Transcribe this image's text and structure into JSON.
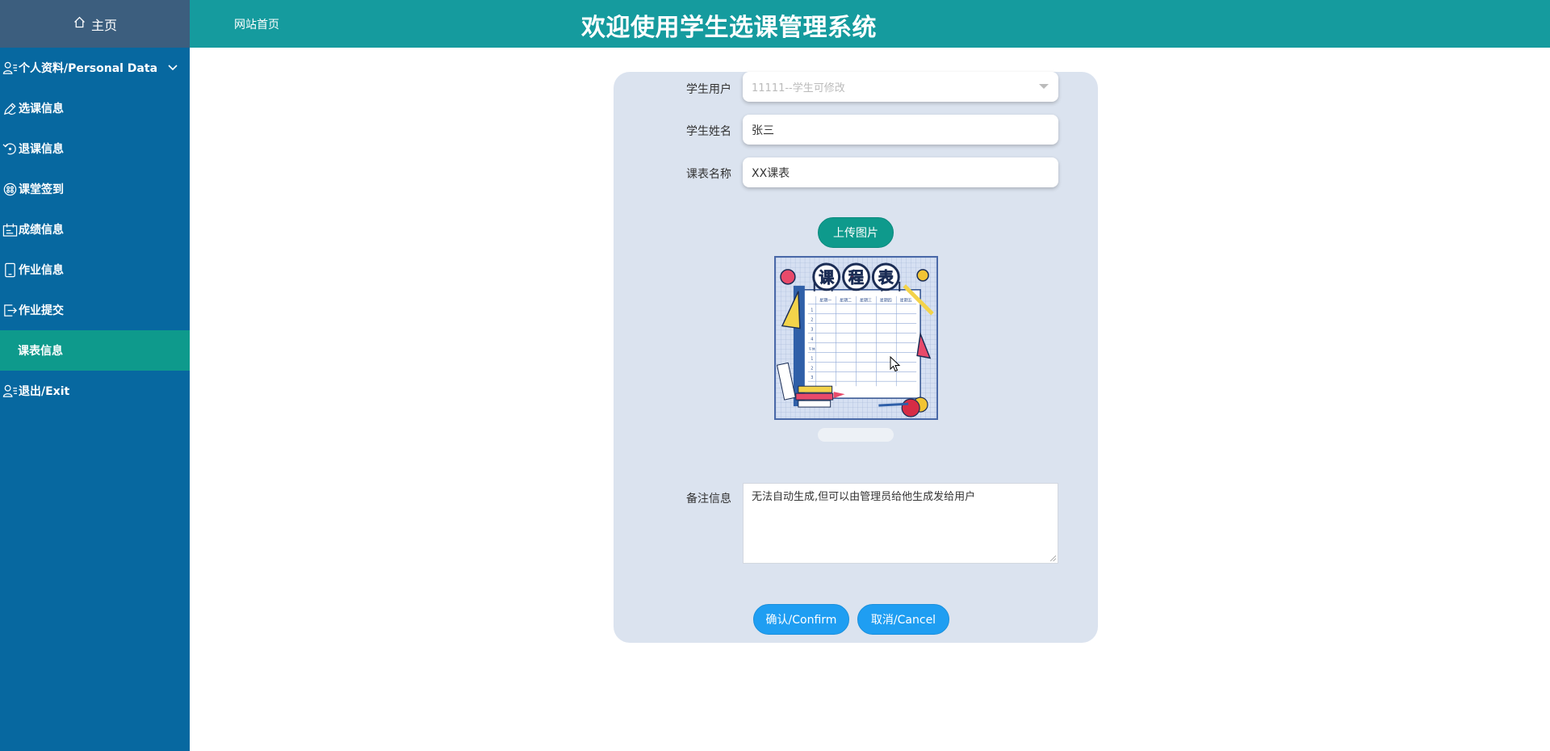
{
  "sidebar": {
    "home": {
      "label": "主页",
      "icon": "home-icon"
    },
    "items": [
      {
        "label": "个人资料/Personal Data",
        "icon": "user-icon",
        "expandable": true
      },
      {
        "label": "选课信息",
        "icon": "pen-icon"
      },
      {
        "label": "退课信息",
        "icon": "undo-icon"
      },
      {
        "label": "课堂签到",
        "icon": "checkin-icon"
      },
      {
        "label": "成绩信息",
        "icon": "score-icon"
      },
      {
        "label": "作业信息",
        "icon": "tablet-icon"
      },
      {
        "label": "作业提交",
        "icon": "submit-icon"
      },
      {
        "label": "课表信息",
        "icon": "",
        "active": true
      },
      {
        "label": "退出/Exit",
        "icon": "user-icon"
      }
    ]
  },
  "header": {
    "link": "网站首页",
    "title": "欢迎使用学生选课管理系统"
  },
  "form": {
    "student_user": {
      "label": "学生用户",
      "value": "11111--学生可修改"
    },
    "student_name": {
      "label": "学生姓名",
      "value": "张三"
    },
    "schedule_name": {
      "label": "课表名称",
      "value": "XX课表"
    },
    "upload_label": "上传图片",
    "image_title_chars": [
      "课",
      "程",
      "表"
    ],
    "image_day_labels": [
      "星期一",
      "星期二",
      "星期三",
      "星期四",
      "星期五"
    ],
    "image_period_labels": [
      "1",
      "2",
      "3",
      "4",
      "午休",
      "1",
      "2",
      "3"
    ],
    "remarks": {
      "label": "备注信息",
      "value": "无法自动生成,但可以由管理员给他生成发给用户"
    },
    "confirm_label": "确认/Confirm",
    "cancel_label": "取消/Cancel"
  },
  "colors": {
    "sidebar_bg": "#0768a0",
    "sidebar_home_bg": "#3c5e7e",
    "header_bg": "#159b9e",
    "active_item_bg": "#0e9a8c",
    "card_bg": "#dbe3ef",
    "button_blue": "#1f9ef2",
    "upload_green": "#0e9a8c"
  }
}
